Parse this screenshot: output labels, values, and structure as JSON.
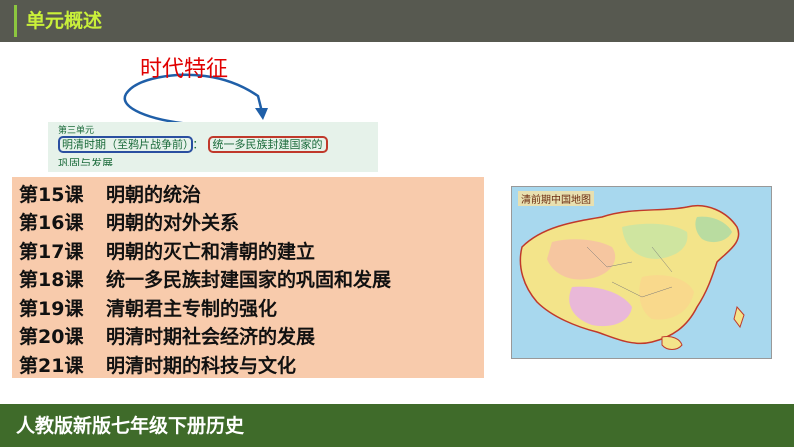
{
  "header": {
    "title": "单元概述"
  },
  "callout": {
    "label": "时代特征"
  },
  "unit": {
    "label": "第三单元",
    "period": "明清时期（至鸦片战争前）",
    "separator": "：",
    "theme": "统一多民族封建国家的",
    "continued": "巩固与发展"
  },
  "lessons": [
    {
      "num": "第15课",
      "title": "明朝的统治"
    },
    {
      "num": "第16课",
      "title": "明朝的对外关系"
    },
    {
      "num": "第17课",
      "title": "明朝的灭亡和清朝的建立"
    },
    {
      "num": "第18课",
      "title": "统一多民族封建国家的巩固和发展"
    },
    {
      "num": "第19课",
      "title": "清朝君主专制的强化"
    },
    {
      "num": "第20课",
      "title": "明清时期社会经济的发展"
    },
    {
      "num": "第21课",
      "title": "明清时期的科技与文化"
    }
  ],
  "map": {
    "title": "清前期中国地图"
  },
  "footer": {
    "title": "人教版新版七年级下册历史"
  },
  "colors": {
    "header_bg": "#575950",
    "header_text": "#c9f03a",
    "footer_bg": "#3f6b2a",
    "lesson_bg": "#f8cbac",
    "accent_red": "#e00000"
  }
}
